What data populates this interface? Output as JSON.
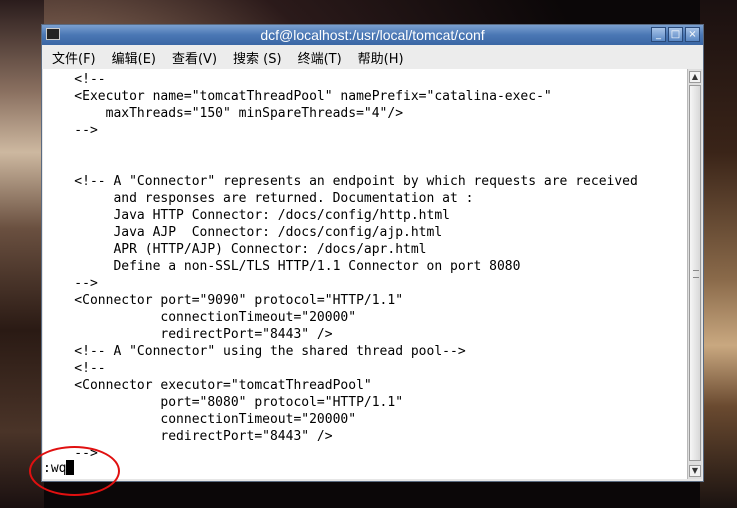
{
  "window": {
    "title": "dcf@localhost:/usr/local/tomcat/conf",
    "buttons": {
      "minimize": "_",
      "maximize": "□",
      "close": "×"
    }
  },
  "menubar": {
    "items": [
      "文件(F)",
      "编辑(E)",
      "查看(V)",
      "搜索 (S)",
      "终端(T)",
      "帮助(H)"
    ]
  },
  "terminal": {
    "content": "    <!--\n    <Executor name=\"tomcatThreadPool\" namePrefix=\"catalina-exec-\"\n        maxThreads=\"150\" minSpareThreads=\"4\"/>\n    -->\n\n\n    <!-- A \"Connector\" represents an endpoint by which requests are received\n         and responses are returned. Documentation at :\n         Java HTTP Connector: /docs/config/http.html\n         Java AJP  Connector: /docs/config/ajp.html\n         APR (HTTP/AJP) Connector: /docs/apr.html\n         Define a non-SSL/TLS HTTP/1.1 Connector on port 8080\n    -->\n    <Connector port=\"9090\" protocol=\"HTTP/1.1\"\n               connectionTimeout=\"20000\"\n               redirectPort=\"8443\" />\n    <!-- A \"Connector\" using the shared thread pool-->\n    <!--\n    <Connector executor=\"tomcatThreadPool\"\n               port=\"8080\" protocol=\"HTTP/1.1\"\n               connectionTimeout=\"20000\"\n               redirectPort=\"8443\" />\n    -->",
    "command": ":wq"
  },
  "colors": {
    "titlebar": "#4a77b4",
    "highlight": "#e01010"
  }
}
